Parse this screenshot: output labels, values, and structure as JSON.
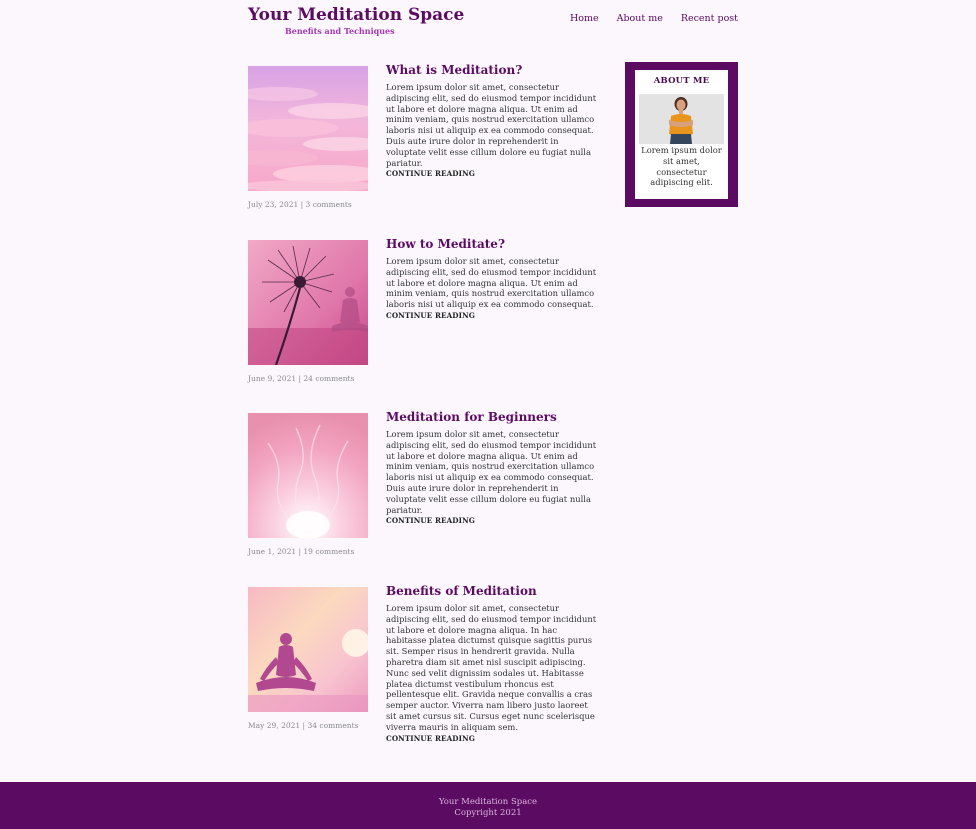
{
  "header": {
    "title": "Your Meditation Space",
    "subtitle": "Benefits and Techniques",
    "nav": [
      "Home",
      "About me",
      "Recent post"
    ]
  },
  "posts": [
    {
      "title": "What is Meditation?",
      "excerpt": "Lorem ipsum dolor sit amet, consectetur adipiscing elit, sed do eiusmod tempor incididunt ut labore et dolore magna aliqua. Ut enim ad minim veniam, quis nostrud exercitation ullamco laboris nisi ut aliquip ex ea commodo consequat. Duis aute irure dolor in reprehenderit in voluptate velit esse cillum dolore eu fugiat nulla pariatur.",
      "read_more": "CONTINUE READING",
      "meta": "July 23, 2021 | 3 comments",
      "image": "pink-clouds-sky-image"
    },
    {
      "title": "How to Meditate?",
      "excerpt": "Lorem ipsum dolor sit amet, consectetur adipiscing elit, sed do eiusmod tempor incididunt ut labore et dolore magna aliqua. Ut enim ad minim veniam, quis nostrud exercitation ullamco laboris nisi ut aliquip ex ea commodo consequat.",
      "read_more": "CONTINUE READING",
      "meta": "June 9, 2021 | 24 comments",
      "image": "dandelion-meditation-image"
    },
    {
      "title": "Meditation for Beginners",
      "excerpt": "Lorem ipsum dolor sit amet, consectetur adipiscing elit, sed do eiusmod tempor incididunt ut labore et dolore magna aliqua. Ut enim ad minim veniam, quis nostrud exercitation ullamco laboris nisi ut aliquip ex ea commodo consequat. Duis aute irure dolor in reprehenderit in voluptate velit esse cillum dolore eu fugiat nulla pariatur.",
      "read_more": "CONTINUE READING",
      "meta": "June 1, 2021 | 19 comments",
      "image": "pink-flame-image"
    },
    {
      "title": "Benefits of Meditation",
      "excerpt": "Lorem ipsum dolor sit amet, consectetur adipiscing elit, sed do eiusmod tempor incididunt ut labore et dolore magna aliqua. In hac habitasse platea dictumst quisque sagittis purus sit. Semper risus in hendrerit gravida. Nulla pharetra diam sit amet nisl suscipit adipiscing. Nunc sed velit dignissim sodales ut. Habitasse platea dictumst vestibulum rhoncus est pellentesque elit. Gravida neque convallis a cras semper auctor. Viverra nam libero justo laoreet sit amet cursus sit. Cursus eget nunc scelerisque viverra mauris in aliquam sem.",
      "read_more": "CONTINUE READING",
      "meta": "May 29, 2021 | 34 comments",
      "image": "lotus-pose-silhouette-image"
    }
  ],
  "sidebar": {
    "heading": "ABOUT ME",
    "text": "Lorem ipsum dolor sit amet, consectetur adipiscing elit.",
    "image": "woman-portrait-avatar"
  },
  "footer": {
    "line1": "Your Meditation Space",
    "line2": "Copyright 2021"
  },
  "colors": {
    "brand": "#5c0b63",
    "accent": "#a43ab2",
    "background": "#fbf7fd"
  }
}
